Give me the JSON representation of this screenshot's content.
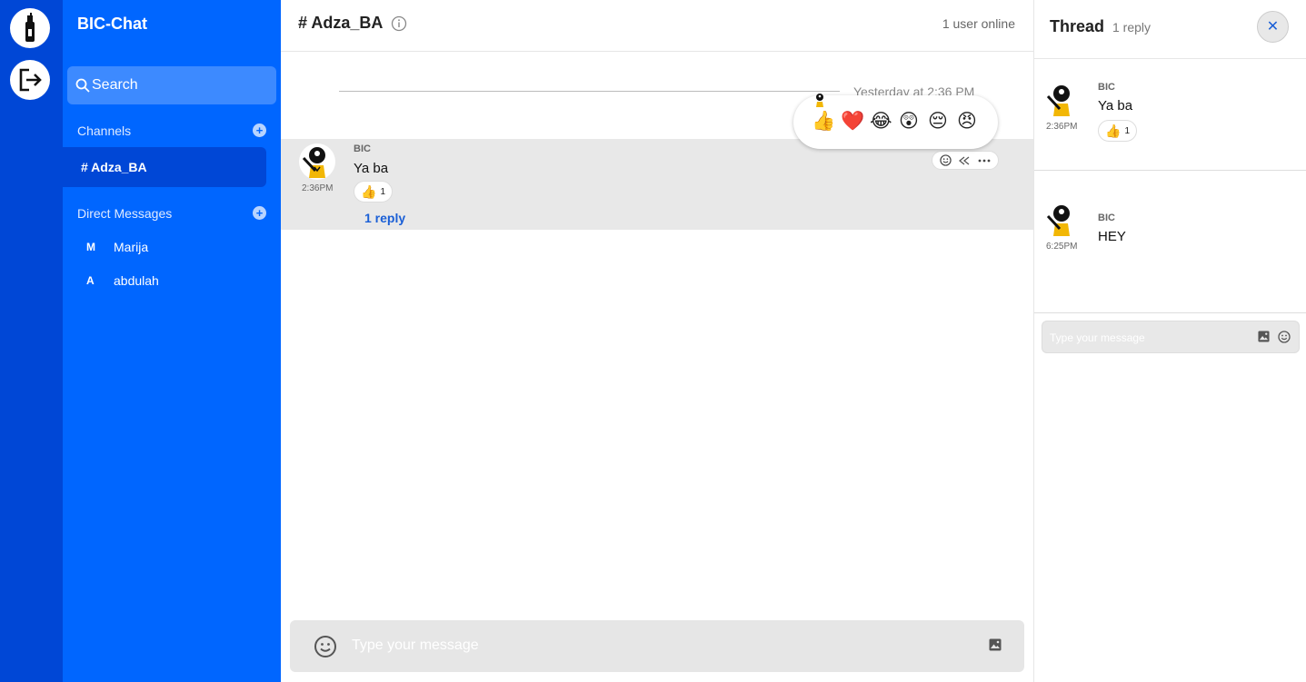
{
  "app": {
    "name": "BIC-Chat"
  },
  "sidebar": {
    "search_label": "Search",
    "channels_title": "Channels",
    "channels": [
      {
        "label": "# Adza_BA",
        "active": true
      }
    ],
    "dm_title": "Direct Messages",
    "dms": [
      {
        "initial": "M",
        "name": "Marija"
      },
      {
        "initial": "A",
        "name": "abdulah"
      }
    ]
  },
  "main": {
    "channel_title": "# Adza_BA",
    "online_status": "1 user online",
    "date_divider": "Yesterday at 2:36 PM",
    "message": {
      "author": "BIC",
      "time": "2:36PM",
      "text": "Ya ba",
      "reaction": {
        "emoji": "👍",
        "count": "1"
      },
      "reply_link": "1 reply"
    },
    "emoji_picker": [
      "👍",
      "❤️",
      "😂",
      "😲",
      "😔",
      "😠"
    ],
    "composer_placeholder": "Type your message"
  },
  "thread": {
    "title": "Thread",
    "reply_count": "1 reply",
    "close_label": "✕",
    "messages": [
      {
        "author": "BIC",
        "time": "2:36PM",
        "text": "Ya ba",
        "reaction": {
          "emoji": "👍",
          "count": "1"
        }
      },
      {
        "author": "BIC",
        "time": "6:25PM",
        "text": "HEY"
      }
    ],
    "composer_placeholder": "Type your message"
  },
  "colors": {
    "rail": "#0047d6",
    "sidebar": "#0066ff",
    "accent": "#1a5fd6"
  }
}
